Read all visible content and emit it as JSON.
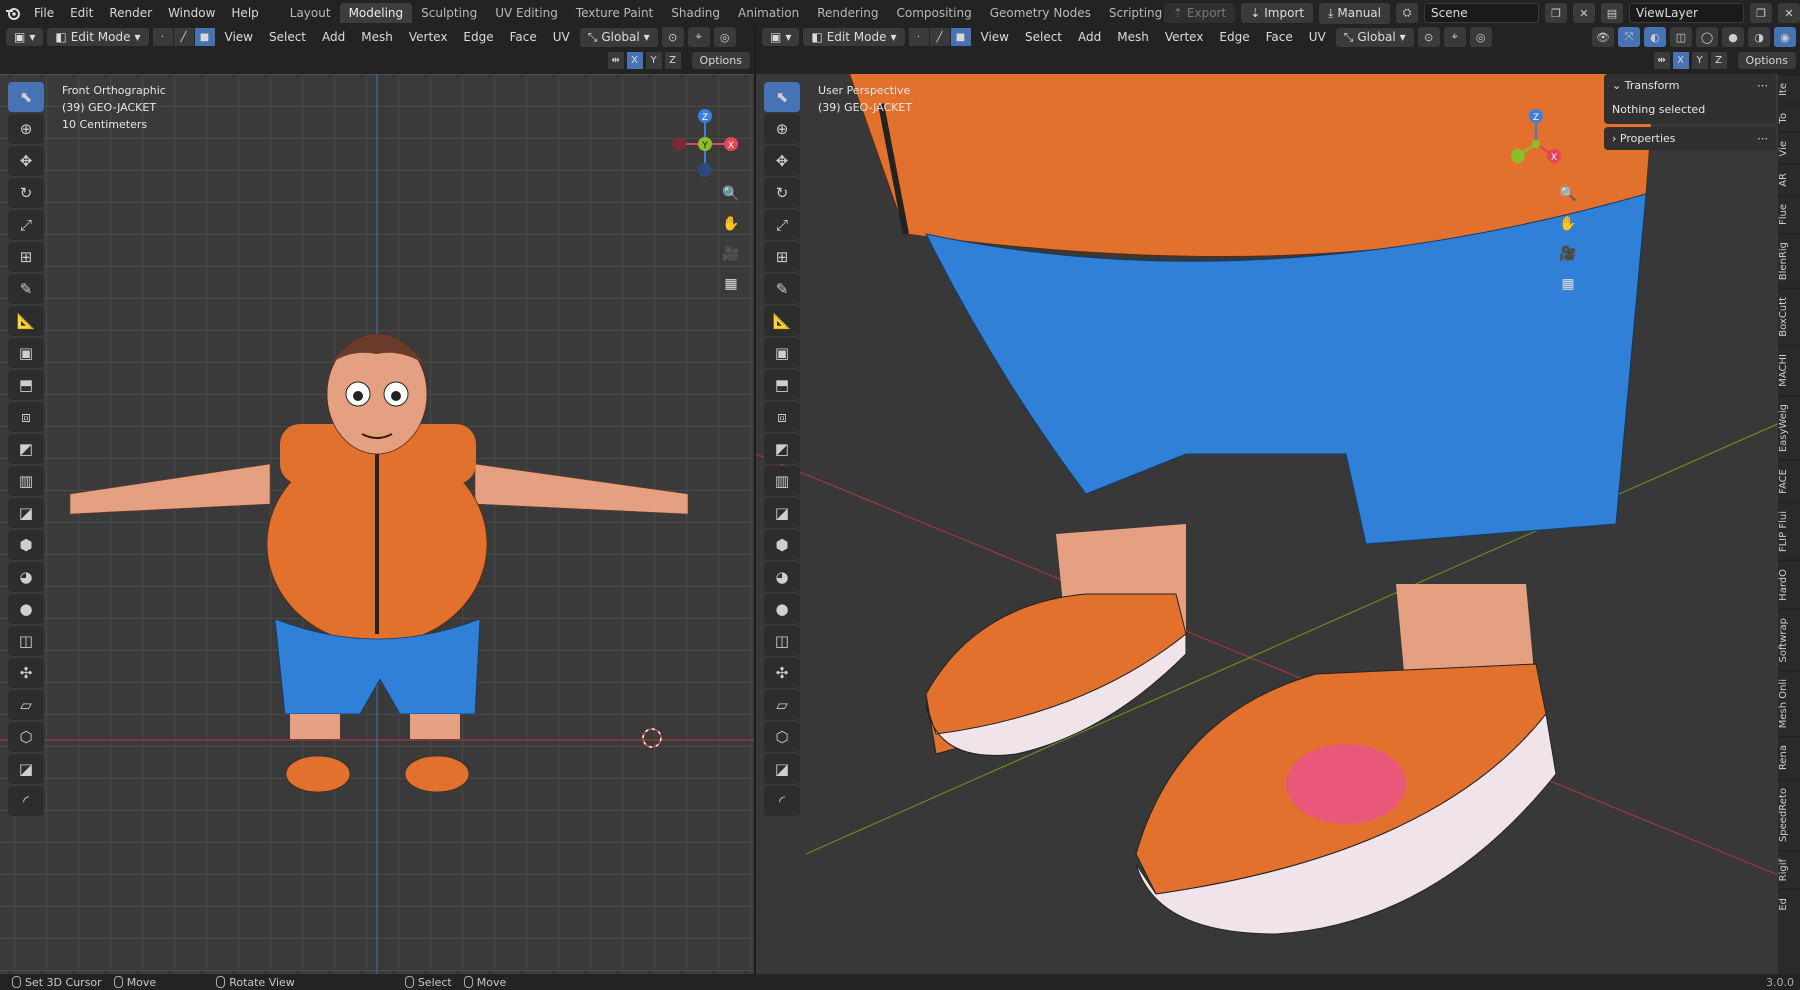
{
  "topbar": {
    "menus": [
      "File",
      "Edit",
      "Render",
      "Window",
      "Help"
    ],
    "workspaces": [
      "Layout",
      "Modeling",
      "Sculpting",
      "UV Editing",
      "Texture Paint",
      "Shading",
      "Animation",
      "Rendering",
      "Compositing",
      "Geometry Nodes",
      "Scripting"
    ],
    "active_workspace": "Modeling",
    "add_tab": "+",
    "export_label": "Export",
    "import_label": "Import",
    "manual_label": "Manual",
    "scene_label": "Scene",
    "viewlayer_label": "ViewLayer"
  },
  "left_editor": {
    "mode": "Edit Mode",
    "menus": [
      "View",
      "Select",
      "Add",
      "Mesh",
      "Vertex",
      "Edge",
      "Face",
      "UV"
    ],
    "orientation": "Global",
    "view_name": "Front Orthographic",
    "object_name": "(39) GEO-JACKET",
    "scale_text": "10 Centimeters",
    "options_label": "Options",
    "axes": [
      "X",
      "Y",
      "Z"
    ]
  },
  "right_editor": {
    "mode": "Edit Mode",
    "menus": [
      "View",
      "Select",
      "Add",
      "Mesh",
      "Vertex",
      "Edge",
      "Face",
      "UV"
    ],
    "orientation": "Global",
    "view_name": "User Perspective",
    "object_name": "(39) GEO-JACKET",
    "options_label": "Options",
    "axes": [
      "X",
      "Y",
      "Z"
    ],
    "transform_title": "Transform",
    "transform_body": "Nothing selected",
    "properties_title": "Properties",
    "side_tabs": [
      "Ite",
      "To",
      "Vie",
      "AR",
      "Flue",
      "BlenRig",
      "BoxCutt",
      "MACHI",
      "EasyWeig",
      "FACE",
      "FLIP Flui",
      "HardO",
      "Softwrap",
      "Mesh Onli",
      "Rena",
      "SpeedReto",
      "Rigif",
      "Ed"
    ]
  },
  "statusbar": {
    "items": [
      "Set 3D Cursor",
      "Move",
      "Rotate View",
      "Select",
      "Move"
    ],
    "version": "3.0.0"
  },
  "colors": {
    "accent": "#4772b3",
    "axis_x": "#e5445a",
    "axis_y": "#8bbf28",
    "axis_z": "#3b7fdc",
    "jacket": "#e1712c",
    "pants": "#2f80d6",
    "skin": "#e4a080"
  }
}
